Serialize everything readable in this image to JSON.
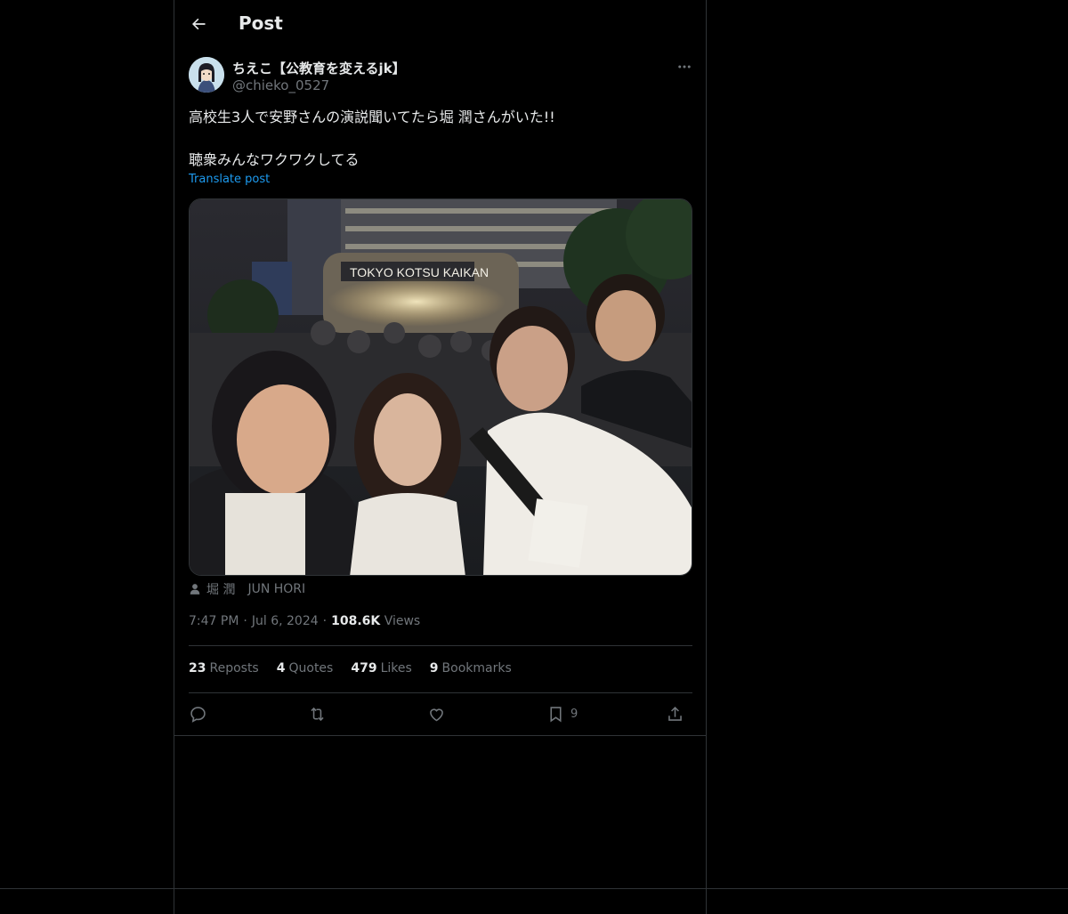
{
  "header": {
    "title": "Post",
    "back_icon": "arrow-left-icon"
  },
  "author": {
    "display_name": "ちえこ【公教育を変えるjk】",
    "handle": "@chieko_0527"
  },
  "tweet": {
    "line1": "高校生3人で安野さんの演説聞いてたら堀 潤さんがいた!!",
    "line2": "聴衆みんなワクワクしてる",
    "translate_label": "Translate post"
  },
  "tagged": {
    "name_jp": "堀 潤",
    "name_en": "JUN HORI"
  },
  "meta": {
    "time": "7:47 PM",
    "date": "Jul 6, 2024",
    "views_count": "108.6K",
    "views_label": "Views"
  },
  "stats": {
    "reposts_count": "23",
    "reposts_label": "Reposts",
    "quotes_count": "4",
    "quotes_label": "Quotes",
    "likes_count": "479",
    "likes_label": "Likes",
    "bookmarks_count": "9",
    "bookmarks_label": "Bookmarks"
  },
  "actions": {
    "bookmark_count": "9"
  },
  "colors": {
    "background": "#000000",
    "text": "#e7e9ea",
    "muted": "#71767b",
    "accent": "#1d9bf0",
    "border": "#2f3336"
  }
}
